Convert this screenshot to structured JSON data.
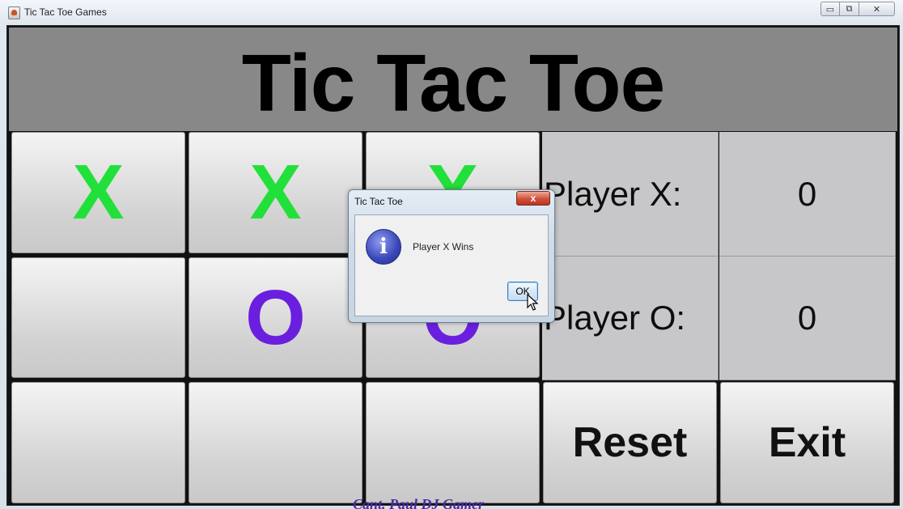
{
  "window": {
    "title": "Tic Tac Toe Games",
    "controls": {
      "minimize": "▭",
      "maximize": "⧉",
      "close": "✕"
    }
  },
  "game": {
    "title": "Tic Tac Toe",
    "board": [
      [
        "X",
        "X",
        "X"
      ],
      [
        "",
        "O",
        "O"
      ],
      [
        "",
        "",
        ""
      ]
    ],
    "colors": {
      "x": "#22e03a",
      "o": "#6a1fdf"
    }
  },
  "scoreboard": {
    "player_x_label": "Player X:",
    "player_x_score": "0",
    "player_o_label": "Player O:",
    "player_o_score": "0"
  },
  "actions": {
    "reset": "Reset",
    "exit": "Exit"
  },
  "dialog": {
    "title": "Tic Tac Toe",
    "close": "x",
    "icon": "info-icon",
    "icon_glyph": "i",
    "message": "Player X Wins",
    "ok": "OK"
  },
  "watermark": "Cant. Paul DJ Gamer"
}
